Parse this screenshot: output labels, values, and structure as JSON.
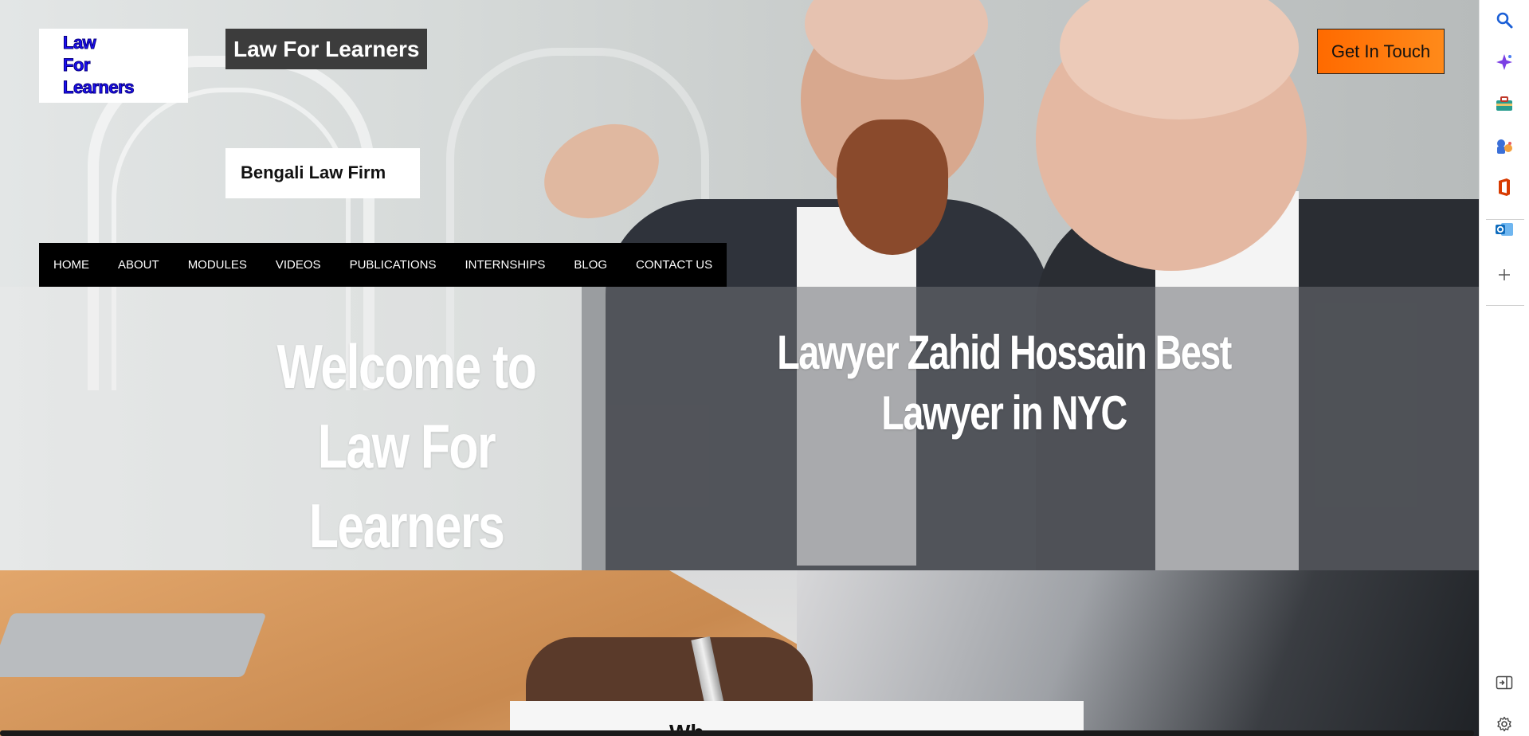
{
  "header": {
    "logo_lines": [
      "Law",
      "For",
      "Learners"
    ],
    "site_title": "Law For Learners",
    "tagline": "Bengali Law Firm",
    "cta_label": "Get In Touch"
  },
  "nav": {
    "items": [
      "HOME",
      "ABOUT",
      "MODULES",
      "VIDEOS",
      "PUBLICATIONS",
      "INTERNSHIPS",
      "BLOG",
      "CONTACT US"
    ]
  },
  "hero": {
    "welcome_heading": "Welcome to Law For Learners",
    "lawyer_heading": "Lawyer Zahid Hossain Best Lawyer in NYC"
  },
  "next_section": {
    "heading_partial": "Wh"
  },
  "colors": {
    "cta_gradient_start": "#ff6a00",
    "nav_background": "#000000",
    "logo_text": "#1a0ff5",
    "title_background": "#3c3c3c"
  },
  "browser_sidebar": {
    "icons": [
      "search-icon",
      "copilot-sparkle-icon",
      "briefcase-icon",
      "games-icon",
      "office-icon",
      "outlook-icon",
      "add-icon",
      "split-screen-icon",
      "settings-icon"
    ]
  }
}
